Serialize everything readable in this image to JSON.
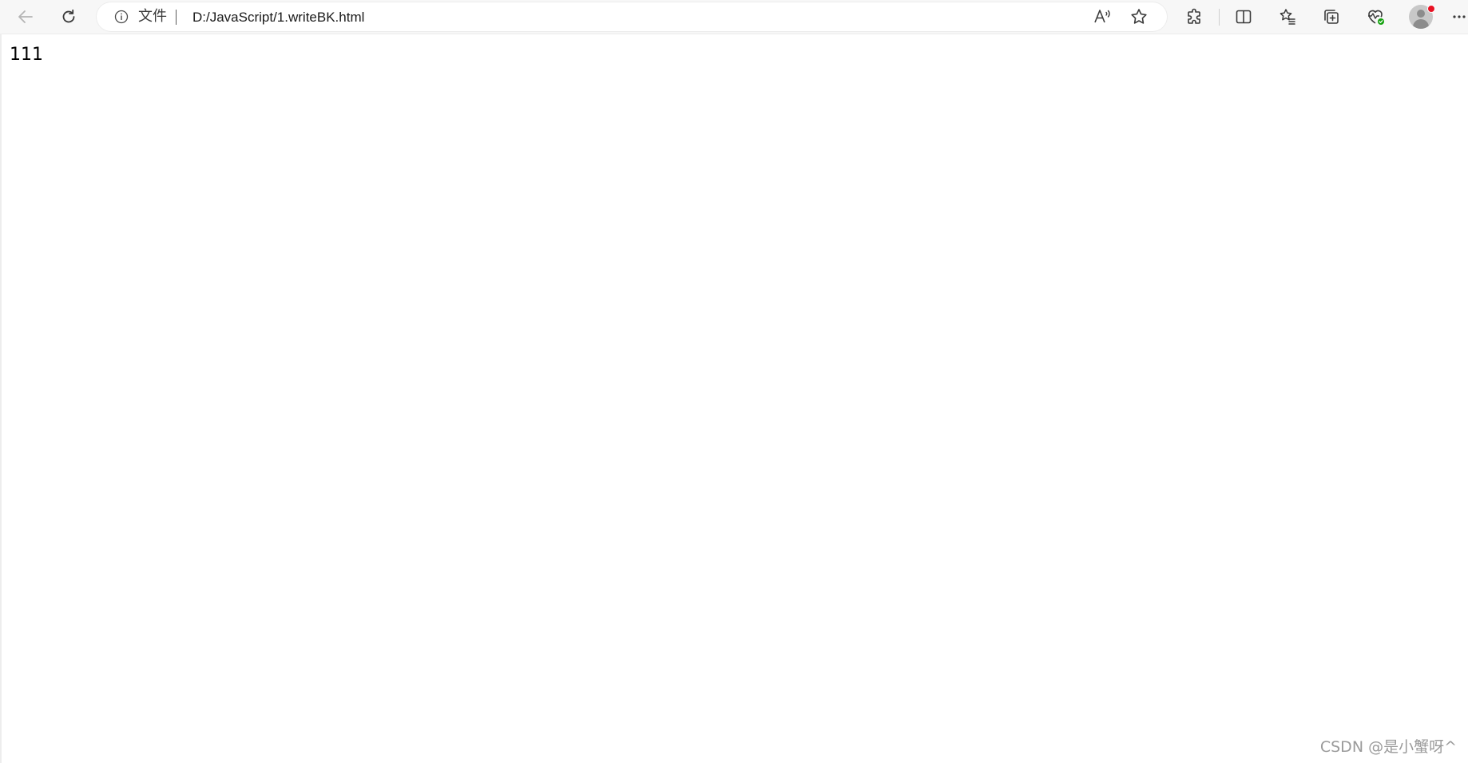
{
  "browser": {
    "address_bar": {
      "site_label": "文件",
      "url": "D:/JavaScript/1.writeBK.html"
    },
    "icons": {
      "back": "back-arrow-icon",
      "refresh": "refresh-icon",
      "info": "info-icon",
      "read_aloud": "read-aloud-icon",
      "favorite": "star-icon",
      "extensions": "puzzle-icon",
      "split_screen": "split-screen-icon",
      "favorites": "favorites-list-icon",
      "collections": "collections-icon",
      "browser_essentials": "heart-pulse-icon",
      "profile": "profile-avatar",
      "more": "more-icon"
    },
    "colors": {
      "toolbar_bg": "#f7f7f7",
      "notification_dot": "#e81123",
      "essentials_badge": "#13a10e"
    }
  },
  "page": {
    "body_text": "111"
  },
  "watermark": {
    "text": "CSDN @是小蟹呀^"
  }
}
